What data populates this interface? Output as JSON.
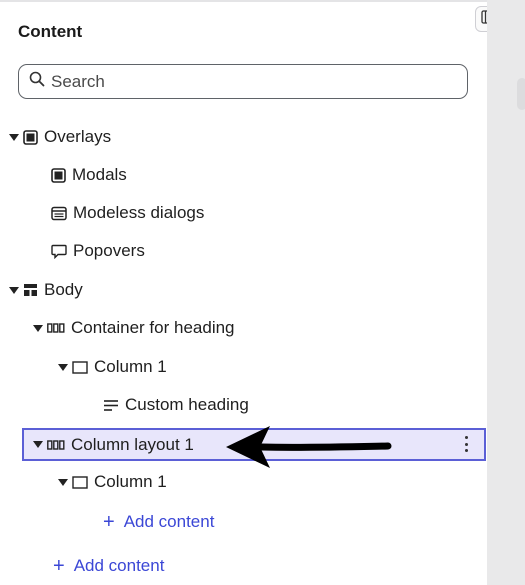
{
  "panel": {
    "title": "Content",
    "collapse_icon": "panel-collapse-icon"
  },
  "search": {
    "placeholder": "Search",
    "icon": "search-icon"
  },
  "tree": {
    "overlays": "Overlays",
    "modals": "Modals",
    "modeless_dialogs": "Modeless dialogs",
    "popovers": "Popovers",
    "body": "Body",
    "container_for_heading": "Container for heading",
    "column_1_a": "Column 1",
    "custom_heading": "Custom heading",
    "column_layout_1": "Column layout 1",
    "column_1_b": "Column 1"
  },
  "actions": {
    "add_content_nested": "Add content",
    "add_content_root": "Add content"
  },
  "colors": {
    "accent": "#3b47d6",
    "selection_bg": "#e8e6fb",
    "selection_border": "#5b5fd6",
    "annotation_arrow": "#000000"
  }
}
